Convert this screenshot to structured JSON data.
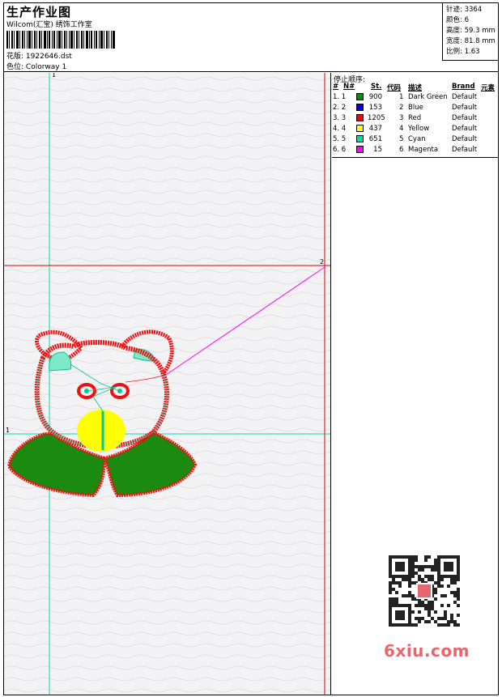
{
  "header": {
    "title": "生产作业图",
    "company": "Wilcom(汇宝) 绣饰工作室",
    "design_label": "花版:",
    "design_value": "1922646.dst",
    "colorway_label": "色位:",
    "colorway_value": "Colorway 1"
  },
  "stats": {
    "stitches_label": "针迹:",
    "stitches_value": "3364",
    "colors_label": "颜色:",
    "colors_value": "6",
    "height_label": "高度:",
    "height_value": "59.3 mm",
    "width_label": "宽度:",
    "width_value": "81.8 mm",
    "scale_label": "比例:",
    "scale_value": "1.63"
  },
  "panel": {
    "title": "停止顺序:",
    "headers": [
      "#",
      "N#",
      "St.",
      "代码",
      "描述",
      "Brand",
      "元素"
    ],
    "rows": [
      {
        "order": "1. 1",
        "color": "#0a8a0a",
        "st": "900",
        "code": "1",
        "desc": "Dark Green",
        "brand": "Default"
      },
      {
        "order": "2. 2",
        "color": "#0000ff",
        "st": "153",
        "code": "2",
        "desc": "Blue",
        "brand": "Default"
      },
      {
        "order": "3. 3",
        "color": "#ff0000",
        "st": "1205",
        "code": "3",
        "desc": "Red",
        "brand": "Default"
      },
      {
        "order": "4. 4",
        "color": "#ffff00",
        "st": "437",
        "code": "4",
        "desc": "Yellow",
        "brand": "Default"
      },
      {
        "order": "5. 5",
        "color": "#00e0a0",
        "st": "651",
        "code": "5",
        "desc": "Cyan",
        "brand": "Default"
      },
      {
        "order": "6. 6",
        "color": "#ff00ff",
        "st": "15",
        "code": "6",
        "desc": "Magenta",
        "brand": "Default"
      }
    ]
  },
  "canvas": {
    "marker_1": "1",
    "marker_2": "2"
  },
  "watermark": {
    "site": "6xiu.com"
  },
  "colors": {
    "guide_cyan": "#00e0a0",
    "guide_red": "#e00000",
    "outline_red": "#ee1111",
    "fill_green": "#1a8a10",
    "fill_yellow": "#ffff00",
    "jump_magenta": "#ff00ff"
  }
}
